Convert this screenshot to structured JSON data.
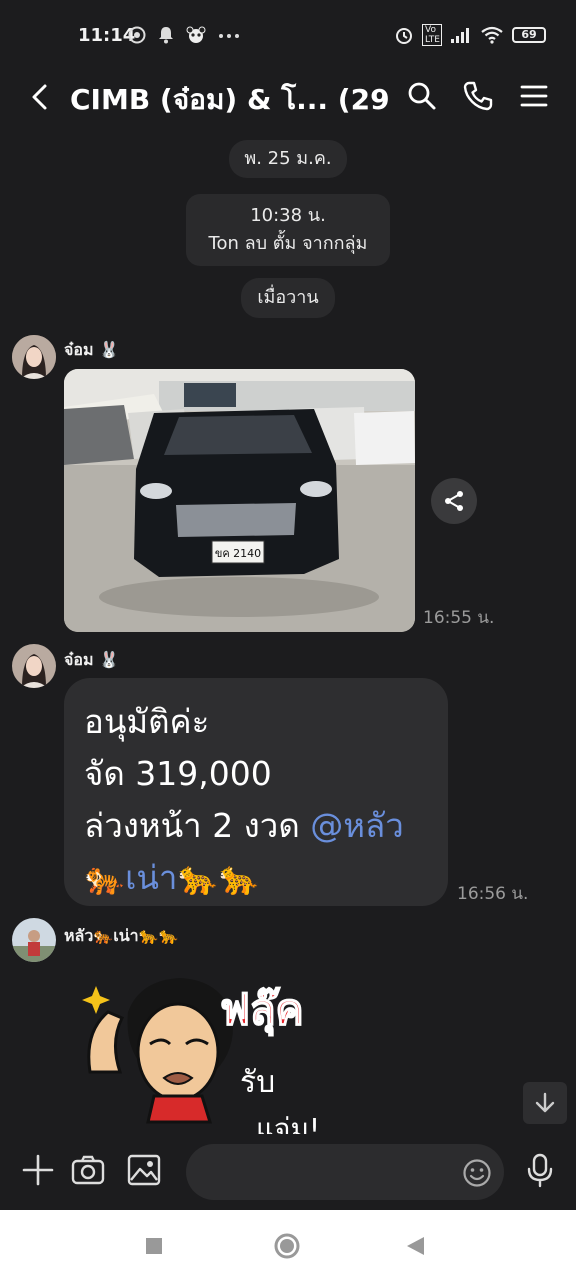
{
  "status_bar": {
    "time": "11:14",
    "left_icons": [
      "chrome-icon",
      "bell-icon",
      "panda-icon",
      "more-dots-icon"
    ],
    "right_icons": [
      "alarm-icon",
      "volte-icon",
      "signal-icon",
      "wifi-icon"
    ],
    "volte_label": "Vo LTE",
    "battery": "69"
  },
  "header": {
    "title": "CIMB (จ๋อม) & โ... (29)"
  },
  "chat": {
    "date_pill": "พ. 25 ม.ค.",
    "system_message": {
      "time": "10:38 น.",
      "text": "Ton ลบ ตั้ม จากกลุ่ม"
    },
    "yesterday_pill": "เมื่อวาน",
    "messages": [
      {
        "sender": "จ๋อม 🐰",
        "type": "image",
        "plate": "ขค 2140",
        "time": "16:55 น."
      },
      {
        "sender": "จ๋อม 🐰",
        "type": "text",
        "lines": [
          "อนุมัติค่ะ",
          "จัด 319,000",
          "ล่วงหน้า 2 งวด "
        ],
        "mention_a": "@หลัว",
        "mention_b": "🐅เน่า",
        "trailing": "🐆🐆",
        "time": "16:56 น."
      },
      {
        "sender": "หลัว🐅เน่า🐆🐆",
        "type": "sticker",
        "sticker_text_1": "ฟลุ๊ค",
        "sticker_text_2": "รับ",
        "sticker_text_3": "แจ่ม!"
      }
    ]
  },
  "input_bar": {
    "placeholder": ""
  },
  "colors": {
    "background": "#1c1c1e",
    "bubble": "#2e2e30",
    "mention": "#6a8fdc",
    "timestamp": "#9b9b9b"
  }
}
